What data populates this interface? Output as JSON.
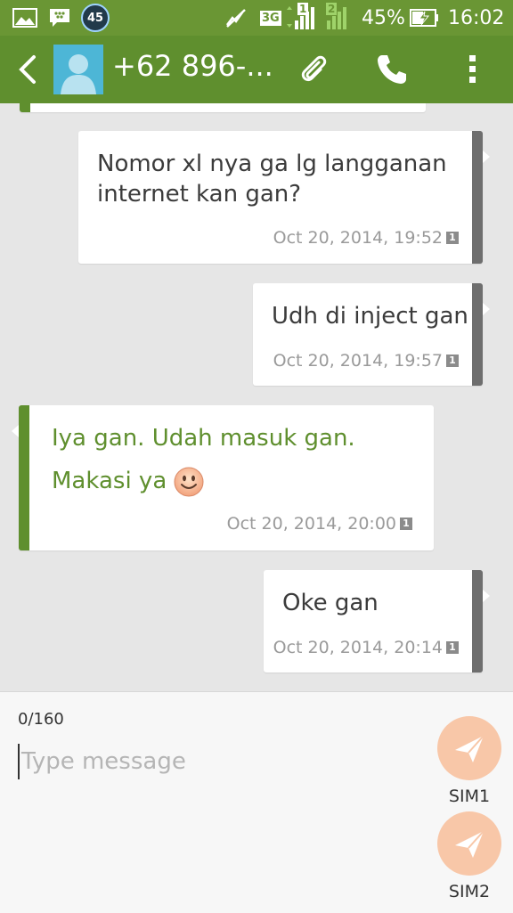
{
  "status_bar": {
    "notification_count": "45",
    "network": "3G",
    "sim1_indicator": "1",
    "sim2_indicator": "2",
    "battery": "45%",
    "time": "16:02"
  },
  "header": {
    "contact": "+62 896-...",
    "icons": [
      "back-arrow-icon",
      "contact-avatar",
      "attach-icon",
      "phone-icon",
      "more-vert-icon"
    ]
  },
  "messages": [
    {
      "direction": "out",
      "text": "Nomor xl nya ga lg langganan internet kan gan?",
      "line1": "Nomor xl nya ga lg langganan",
      "line2": "internet kan gan?",
      "time": "Oct 20, 2014, 19:52",
      "sim": "1"
    },
    {
      "direction": "out",
      "text": "Udh di inject gan",
      "time": "Oct 20, 2014, 19:57",
      "sim": "1"
    },
    {
      "direction": "in",
      "line1": "Iya gan. Udah masuk gan.",
      "line2": "Makasi ya",
      "emoji": "smiley-emoji",
      "time": "Oct 20, 2014, 20:00",
      "sim": "1"
    },
    {
      "direction": "out",
      "text": "Oke gan",
      "time": "Oct 20, 2014, 20:14",
      "sim": "1"
    }
  ],
  "compose": {
    "counter": "0/160",
    "placeholder": "Type message",
    "sim1_label": "SIM1",
    "sim2_label": "SIM2"
  },
  "colors": {
    "primary": "#5f8f2e",
    "status_bar": "#6a9634",
    "send_button": "#f8c7a8",
    "outgoing_accent": "#6e6e6e",
    "background": "#e6e6e6"
  }
}
